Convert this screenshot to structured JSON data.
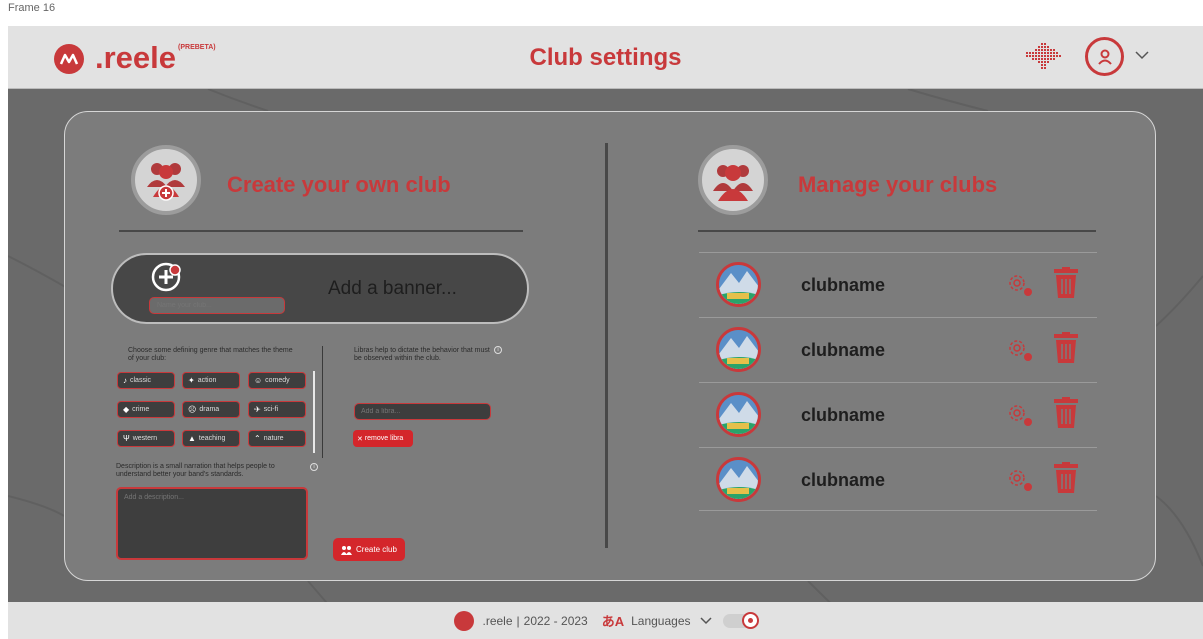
{
  "frame_label": "Frame 16",
  "header": {
    "logo_text": ".reele",
    "logo_badge": "(PREBETA)",
    "title": "Club settings"
  },
  "create": {
    "title": "Create your own club",
    "banner_text": "Add a banner...",
    "name_placeholder": "Name your club...",
    "genre_hint": "Choose some defining genre that matches the theme of your club:",
    "genres": [
      {
        "label": "classic",
        "icon": "violin-icon"
      },
      {
        "label": "action",
        "icon": "action-icon"
      },
      {
        "label": "comedy",
        "icon": "comedy-mask-icon"
      },
      {
        "label": "crime",
        "icon": "crime-icon"
      },
      {
        "label": "drama",
        "icon": "drama-mask-icon"
      },
      {
        "label": "sci-fi",
        "icon": "sci-fi-icon"
      },
      {
        "label": "western",
        "icon": "cactus-icon"
      },
      {
        "label": "teaching",
        "icon": "graduation-cap-icon"
      },
      {
        "label": "nature",
        "icon": "mountain-icon"
      }
    ],
    "libra_hint": "Libras help to dictate the behavior that must be observed within the club.",
    "libra_placeholder": "Add a libra...",
    "remove_libra_label": "remove libra",
    "description_hint": "Description is a small narration that helps people to understand better your band's standards.",
    "description_placeholder": "Add a description...",
    "create_label": "Create club"
  },
  "manage": {
    "title": "Manage your clubs",
    "clubs": [
      {
        "name": "clubname"
      },
      {
        "name": "clubname"
      },
      {
        "name": "clubname"
      },
      {
        "name": "clubname"
      }
    ]
  },
  "footer": {
    "brand": ".reele",
    "years": "2022 - 2023",
    "languages_label": "Languages"
  },
  "colors": {
    "accent": "#c8393b",
    "button_red": "#d4262b",
    "background": "#6a6a6a",
    "card": "#7c7c7c",
    "bar": "#e2e2e2"
  }
}
